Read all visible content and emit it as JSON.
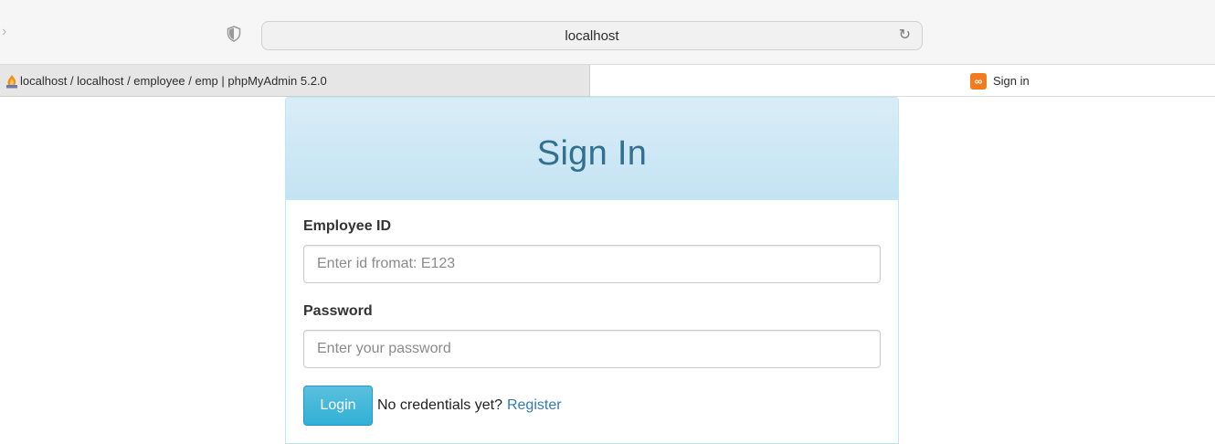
{
  "browser": {
    "address": "localhost",
    "tabs": [
      {
        "label": "localhost / localhost / employee / emp | phpMyAdmin 5.2.0",
        "active": true,
        "icon": "phpmyadmin-icon"
      },
      {
        "label": "Sign in",
        "active": false,
        "icon": "xampp-icon"
      }
    ]
  },
  "signin": {
    "title": "Sign In",
    "employee_id": {
      "label": "Employee ID",
      "value": "",
      "placeholder": "Enter id fromat: E123"
    },
    "password": {
      "label": "Password",
      "value": "",
      "placeholder": "Enter your password"
    },
    "login_label": "Login",
    "prompt": "No credentials yet?",
    "register_label": "Register"
  },
  "colors": {
    "heading_bg": "#d9edf7",
    "heading_text": "#31708f",
    "button": "#31b0d5",
    "link": "#337ab7"
  }
}
